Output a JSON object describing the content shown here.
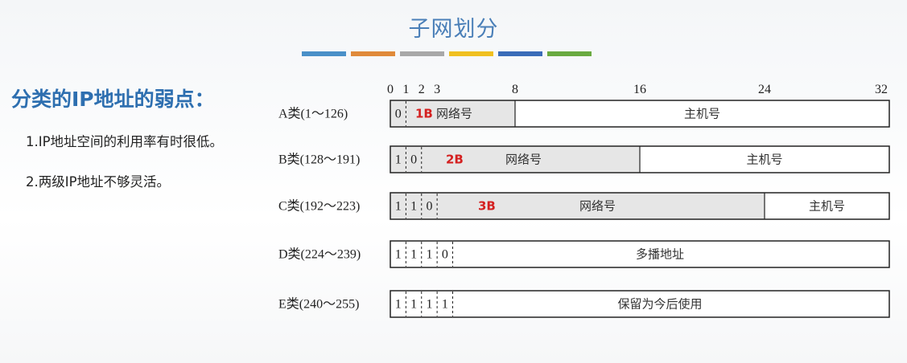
{
  "title": "子网划分",
  "accent_colors": [
    "#4a90c8",
    "#e08a3a",
    "#a8a8a8",
    "#f0c020",
    "#3a6cb8",
    "#6aaa40"
  ],
  "heading": "分类的IP地址的弱点：",
  "points": [
    "1.IP地址空间的利用率有时很低。",
    "2.两级IP地址不够灵活。"
  ],
  "ticks": [
    "0",
    "1",
    "2",
    "3",
    "8",
    "16",
    "24",
    "32"
  ],
  "classes": [
    {
      "label": "A类(1～126)",
      "bits": [
        "0"
      ],
      "byte": "1B",
      "net_label": "网络号",
      "host_label": "主机号"
    },
    {
      "label": "B类(128～191)",
      "bits": [
        "1",
        "0"
      ],
      "byte": "2B",
      "net_label": "网络号",
      "host_label": "主机号"
    },
    {
      "label": "C类(192～223)",
      "bits": [
        "1",
        "1",
        "0"
      ],
      "byte": "3B",
      "net_label": "网络号",
      "host_label": "主机号"
    },
    {
      "label": "D类(224～239)",
      "bits": [
        "1",
        "1",
        "1",
        "0"
      ],
      "field_label": "多播地址"
    },
    {
      "label": "E类(240～255)",
      "bits": [
        "1",
        "1",
        "1",
        "1"
      ],
      "field_label": "保留为今后使用"
    }
  ]
}
